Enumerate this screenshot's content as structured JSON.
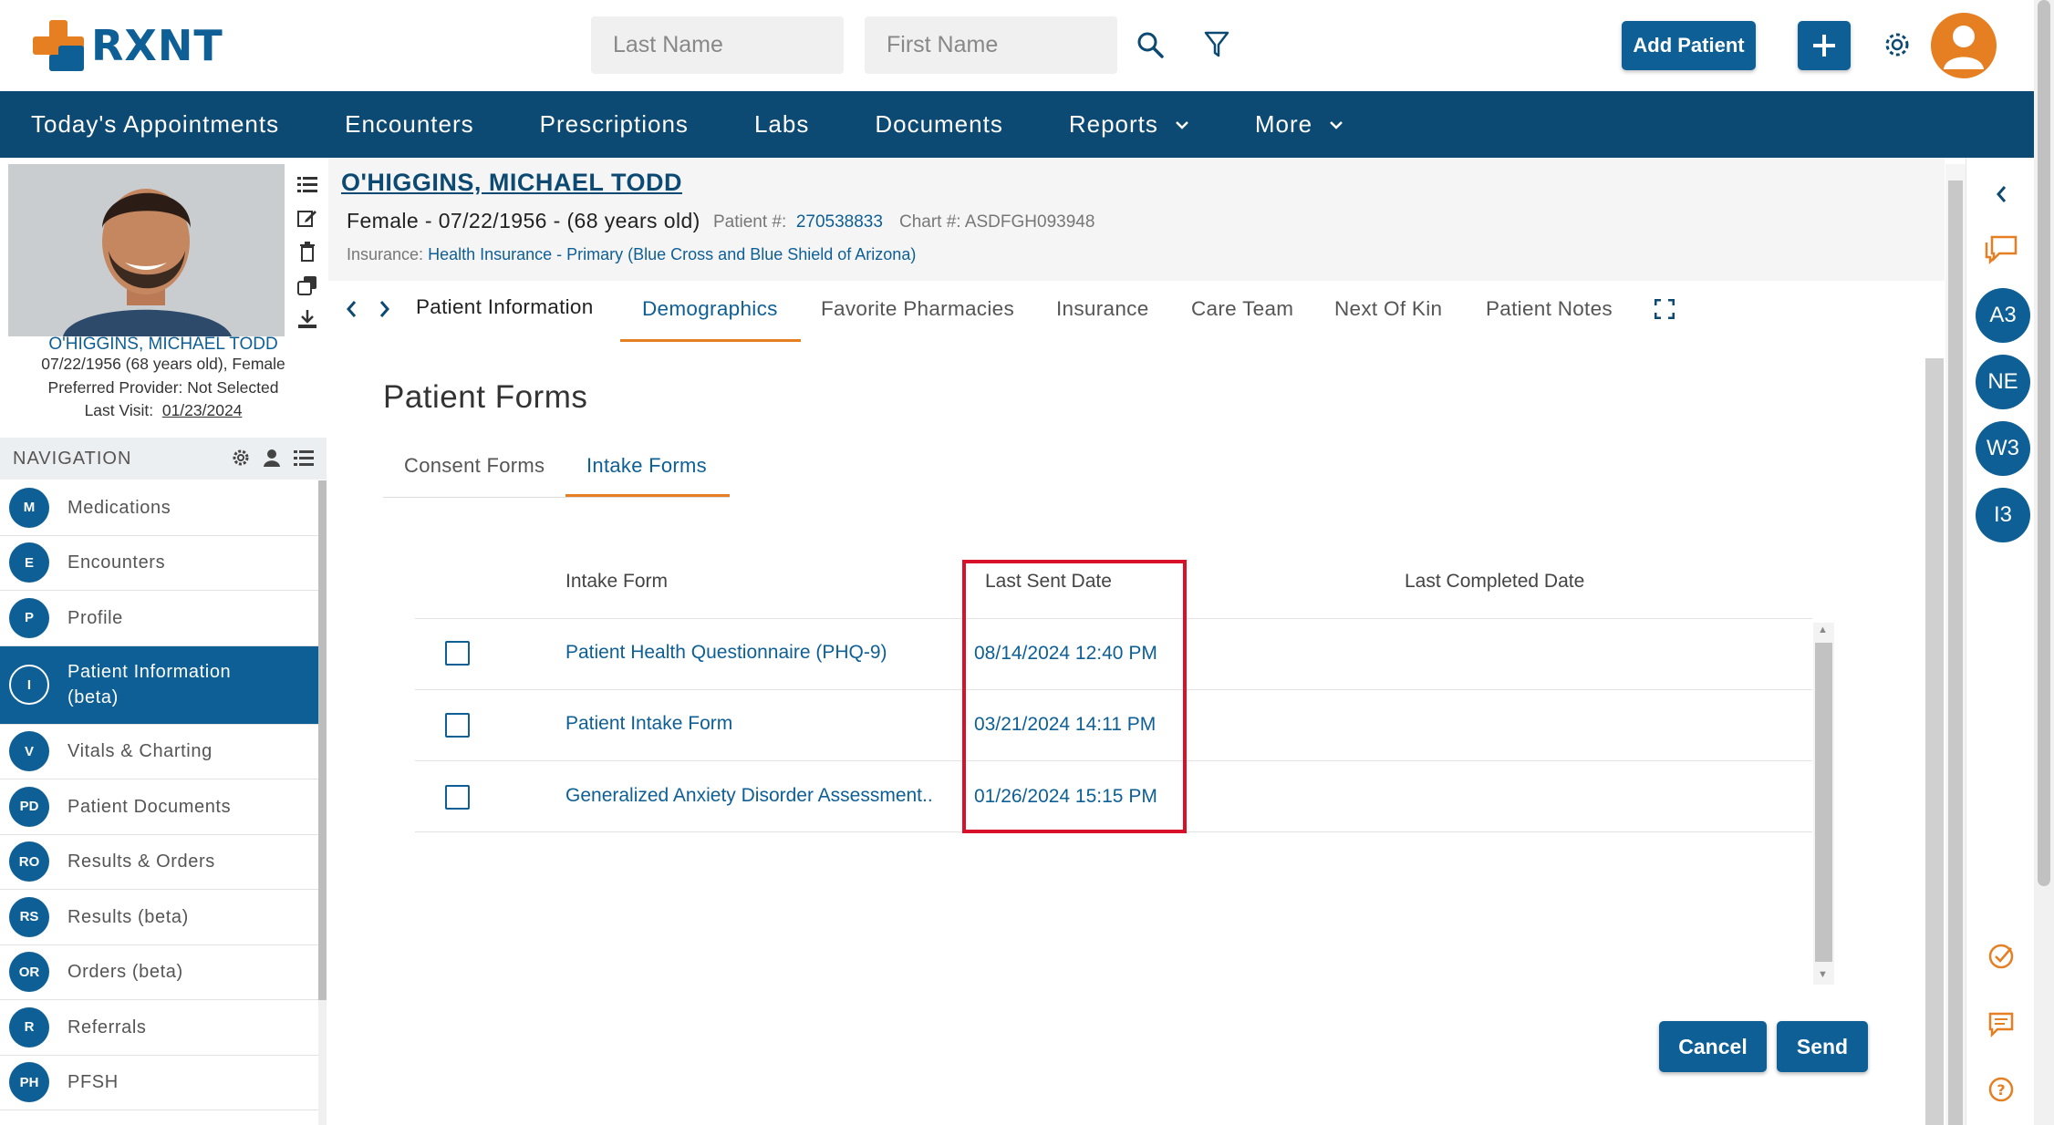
{
  "brand": {
    "name": "RXNT",
    "accent": "#0d5f96",
    "orange": "#e67e22",
    "nav_bg": "#0d4a73"
  },
  "header": {
    "last_name_placeholder": "Last Name",
    "first_name_placeholder": "First Name",
    "add_patient_label": "Add Patient",
    "add_icon": "plus-icon",
    "search_icon": "search-icon",
    "filter_icon": "filter-icon",
    "settings_icon": "gear-icon",
    "avatar_icon": "user-avatar-icon"
  },
  "main_nav": {
    "items": [
      {
        "label": "Today's Appointments",
        "has_dropdown": false
      },
      {
        "label": "Encounters",
        "has_dropdown": false
      },
      {
        "label": "Prescriptions",
        "has_dropdown": false
      },
      {
        "label": "Labs",
        "has_dropdown": false
      },
      {
        "label": "Documents",
        "has_dropdown": false
      },
      {
        "label": "Reports",
        "has_dropdown": true
      },
      {
        "label": "More",
        "has_dropdown": true
      }
    ]
  },
  "patient_card": {
    "name": "O'HIGGINS, MICHAEL TODD",
    "dob_line": "07/22/1956 (68 years old), Female",
    "provider_line": "Preferred Provider: Not Selected",
    "last_visit_label": "Last Visit:",
    "last_visit_date": "01/23/2024",
    "tools": [
      "list-icon",
      "edit-icon",
      "trash-icon",
      "copy-icon",
      "download-icon"
    ]
  },
  "navigation": {
    "title": "NAVIGATION",
    "tools": [
      "gear-icon",
      "person-icon",
      "list-icon"
    ],
    "items": [
      {
        "badge": "M",
        "label": "Medications",
        "active": false
      },
      {
        "badge": "E",
        "label": "Encounters",
        "active": false
      },
      {
        "badge": "P",
        "label": "Profile",
        "active": false
      },
      {
        "badge": "I",
        "label": "Patient Information (beta)",
        "active": true
      },
      {
        "badge": "V",
        "label": "Vitals & Charting",
        "active": false
      },
      {
        "badge": "PD",
        "label": "Patient Documents",
        "active": false
      },
      {
        "badge": "RO",
        "label": "Results & Orders",
        "active": false
      },
      {
        "badge": "RS",
        "label": "Results (beta)",
        "active": false
      },
      {
        "badge": "OR",
        "label": "Orders (beta)",
        "active": false
      },
      {
        "badge": "R",
        "label": "Referrals",
        "active": false
      },
      {
        "badge": "PH",
        "label": "PFSH",
        "active": false
      }
    ]
  },
  "patient_header": {
    "name": "O'HIGGINS, MICHAEL TODD",
    "summary": "Female - 07/22/1956 - (68 years old)",
    "patient_num_label": "Patient #:",
    "patient_num": "270538833",
    "chart_num_label": "Chart #:",
    "chart_num": "ASDFGH093948",
    "insurance_label": "Insurance:",
    "insurance_value": "Health Insurance - Primary (Blue Cross and Blue Shield of Arizona)"
  },
  "tabs": {
    "items": [
      "Patient Information",
      "Demographics",
      "Favorite Pharmacies",
      "Insurance",
      "Care Team",
      "Next Of Kin",
      "Patient Notes"
    ],
    "active": "Demographics"
  },
  "forms": {
    "title": "Patient Forms",
    "subtabs": [
      "Consent Forms",
      "Intake Forms"
    ],
    "active_subtab": "Intake Forms",
    "columns": [
      "Intake Form",
      "Last Sent Date",
      "Last Completed Date"
    ],
    "rows": [
      {
        "form": "Patient Health Questionnaire (PHQ-9)",
        "last_sent": "08/14/2024 12:40 PM",
        "last_completed": "",
        "checked": false
      },
      {
        "form": "Patient Intake Form",
        "last_sent": "03/21/2024 14:11 PM",
        "last_completed": "",
        "checked": false
      },
      {
        "form": "Generalized Anxiety Disorder Assessment..",
        "last_sent": "01/26/2024 15:15 PM",
        "last_completed": "",
        "checked": false
      }
    ],
    "cancel_label": "Cancel",
    "send_label": "Send"
  },
  "right_rail": {
    "circles": [
      "A3",
      "NE",
      "W3",
      "I3"
    ],
    "icons": [
      "collapse-left-icon",
      "chat-bubbles-icon",
      "check-circle-icon",
      "message-icon",
      "help-icon"
    ]
  }
}
